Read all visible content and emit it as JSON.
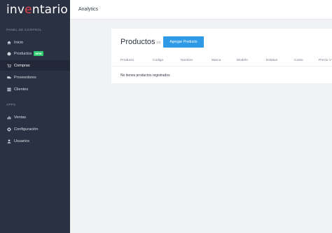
{
  "brand": {
    "name_prefix": "inv",
    "name_hl": "e",
    "name_suffix": "ntario"
  },
  "sidebar": {
    "section_panel": "PANEL DE CONTROL",
    "section_apps": "APPS",
    "items": [
      {
        "label": "Inicio",
        "icon": "home-icon"
      },
      {
        "label": "Productos",
        "icon": "box-icon",
        "badge": "NEW"
      },
      {
        "label": "Compras",
        "icon": "cart-icon"
      },
      {
        "label": "Proveedores",
        "icon": "truck-icon"
      },
      {
        "label": "Clientes",
        "icon": "list-icon"
      }
    ],
    "apps": [
      {
        "label": "Ventas",
        "icon": "chart-icon"
      },
      {
        "label": "Configuración",
        "icon": "gear-icon"
      },
      {
        "label": "Usuarios",
        "icon": "user-icon"
      }
    ]
  },
  "topbar": {
    "title": "Analytics"
  },
  "products": {
    "title": "Productos",
    "subtitle": "(0)",
    "add_button": "Agregar Producto",
    "columns": [
      "Producto",
      "Codigo",
      "Nombre",
      "Marca",
      "Modelo",
      "Estatus",
      "Costo",
      "Precio V"
    ],
    "empty_message": "No tienes productos registrados"
  },
  "colors": {
    "sidebar_bg": "#2a3142",
    "accent": "#2f9be7",
    "logo_hl": "#e8414d",
    "badge": "#2ecc71"
  }
}
